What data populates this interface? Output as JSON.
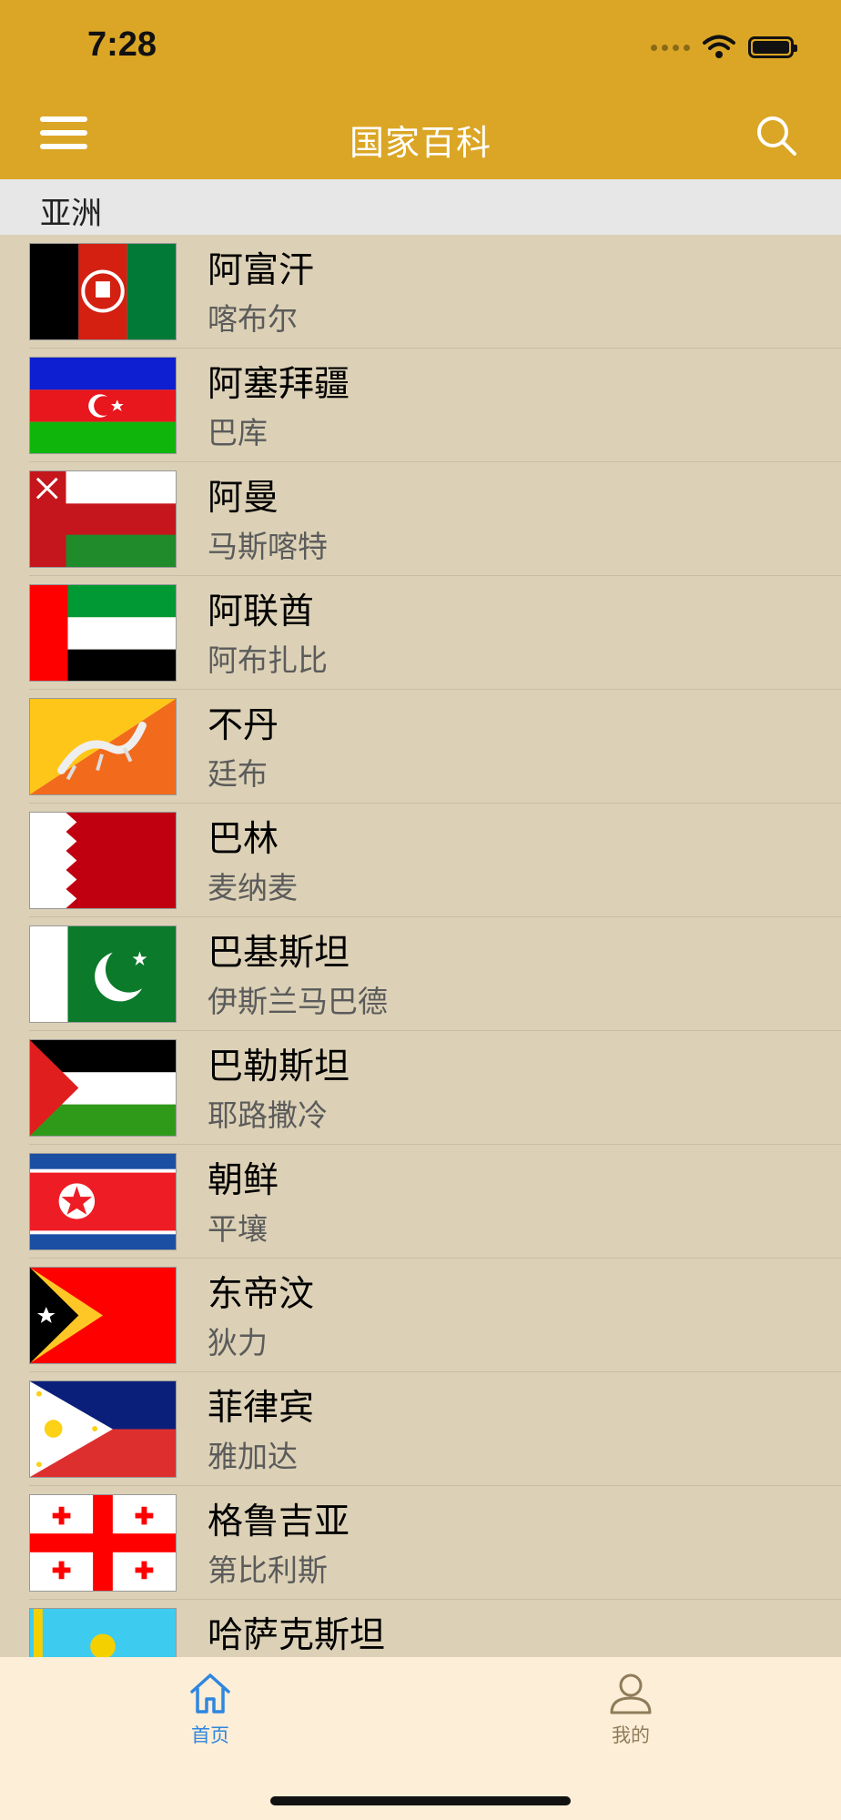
{
  "status": {
    "time": "7:28"
  },
  "nav": {
    "title": "国家百科"
  },
  "section": {
    "title": "亚洲"
  },
  "countries": [
    {
      "name": "阿富汗",
      "capital": "喀布尔",
      "flag": "afghanistan-flag"
    },
    {
      "name": "阿塞拜疆",
      "capital": "巴库",
      "flag": "azerbaijan-flag"
    },
    {
      "name": "阿曼",
      "capital": "马斯喀特",
      "flag": "oman-flag"
    },
    {
      "name": "阿联酋",
      "capital": "阿布扎比",
      "flag": "uae-flag"
    },
    {
      "name": "不丹",
      "capital": "廷布",
      "flag": "bhutan-flag"
    },
    {
      "name": "巴林",
      "capital": "麦纳麦",
      "flag": "bahrain-flag"
    },
    {
      "name": "巴基斯坦",
      "capital": "伊斯兰马巴德",
      "flag": "pakistan-flag"
    },
    {
      "name": "巴勒斯坦",
      "capital": "耶路撒冷",
      "flag": "palestine-flag"
    },
    {
      "name": "朝鲜",
      "capital": "平壤",
      "flag": "north-korea-flag"
    },
    {
      "name": "东帝汶",
      "capital": "狄力",
      "flag": "east-timor-flag"
    },
    {
      "name": "菲律宾",
      "capital": "雅加达",
      "flag": "philippines-flag"
    },
    {
      "name": "格鲁吉亚",
      "capital": "第比利斯",
      "flag": "georgia-flag"
    },
    {
      "name": "哈萨克斯坦",
      "capital": "",
      "flag": "kazakhstan-flag"
    }
  ],
  "tabs": [
    {
      "label": "首页",
      "icon": "home-icon",
      "active": true
    },
    {
      "label": "我的",
      "icon": "person-icon",
      "active": false
    }
  ],
  "colors": {
    "accent": "#dba625",
    "tab_active": "#2f86e0",
    "tab_inactive": "#8e7c5a",
    "list_bg": "#dcd1b6"
  }
}
